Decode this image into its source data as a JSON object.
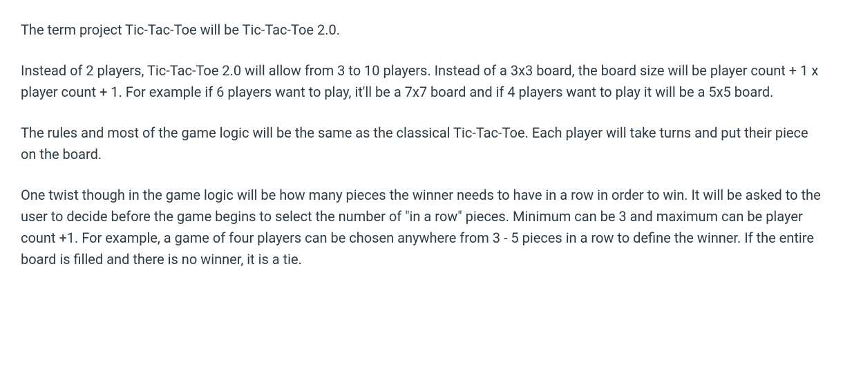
{
  "paragraphs": [
    "The term project Tic-Tac-Toe will be Tic-Tac-Toe 2.0.",
    "Instead of 2 players, Tic-Tac-Toe 2.0 will allow from 3 to 10 players. Instead of a 3x3 board, the board size will be player count + 1 x player count + 1. For example if 6 players want to play, it'll be a 7x7 board and if 4 players want to play it will be a 5x5 board.",
    "The rules and most of the game logic will be the same as the classical Tic-Tac-Toe. Each player will take turns and put their piece on the board.",
    "One twist though in the game logic will be how many pieces the winner needs to have in a row in order to win. It will be asked to the user to decide before the game begins to select the number of \"in a row\" pieces. Minimum can be 3 and maximum can be player count +1. For example, a game of four players can be chosen anywhere from 3 - 5 pieces in a row to define the winner. If the entire board is filled and there is no winner, it is a tie."
  ]
}
